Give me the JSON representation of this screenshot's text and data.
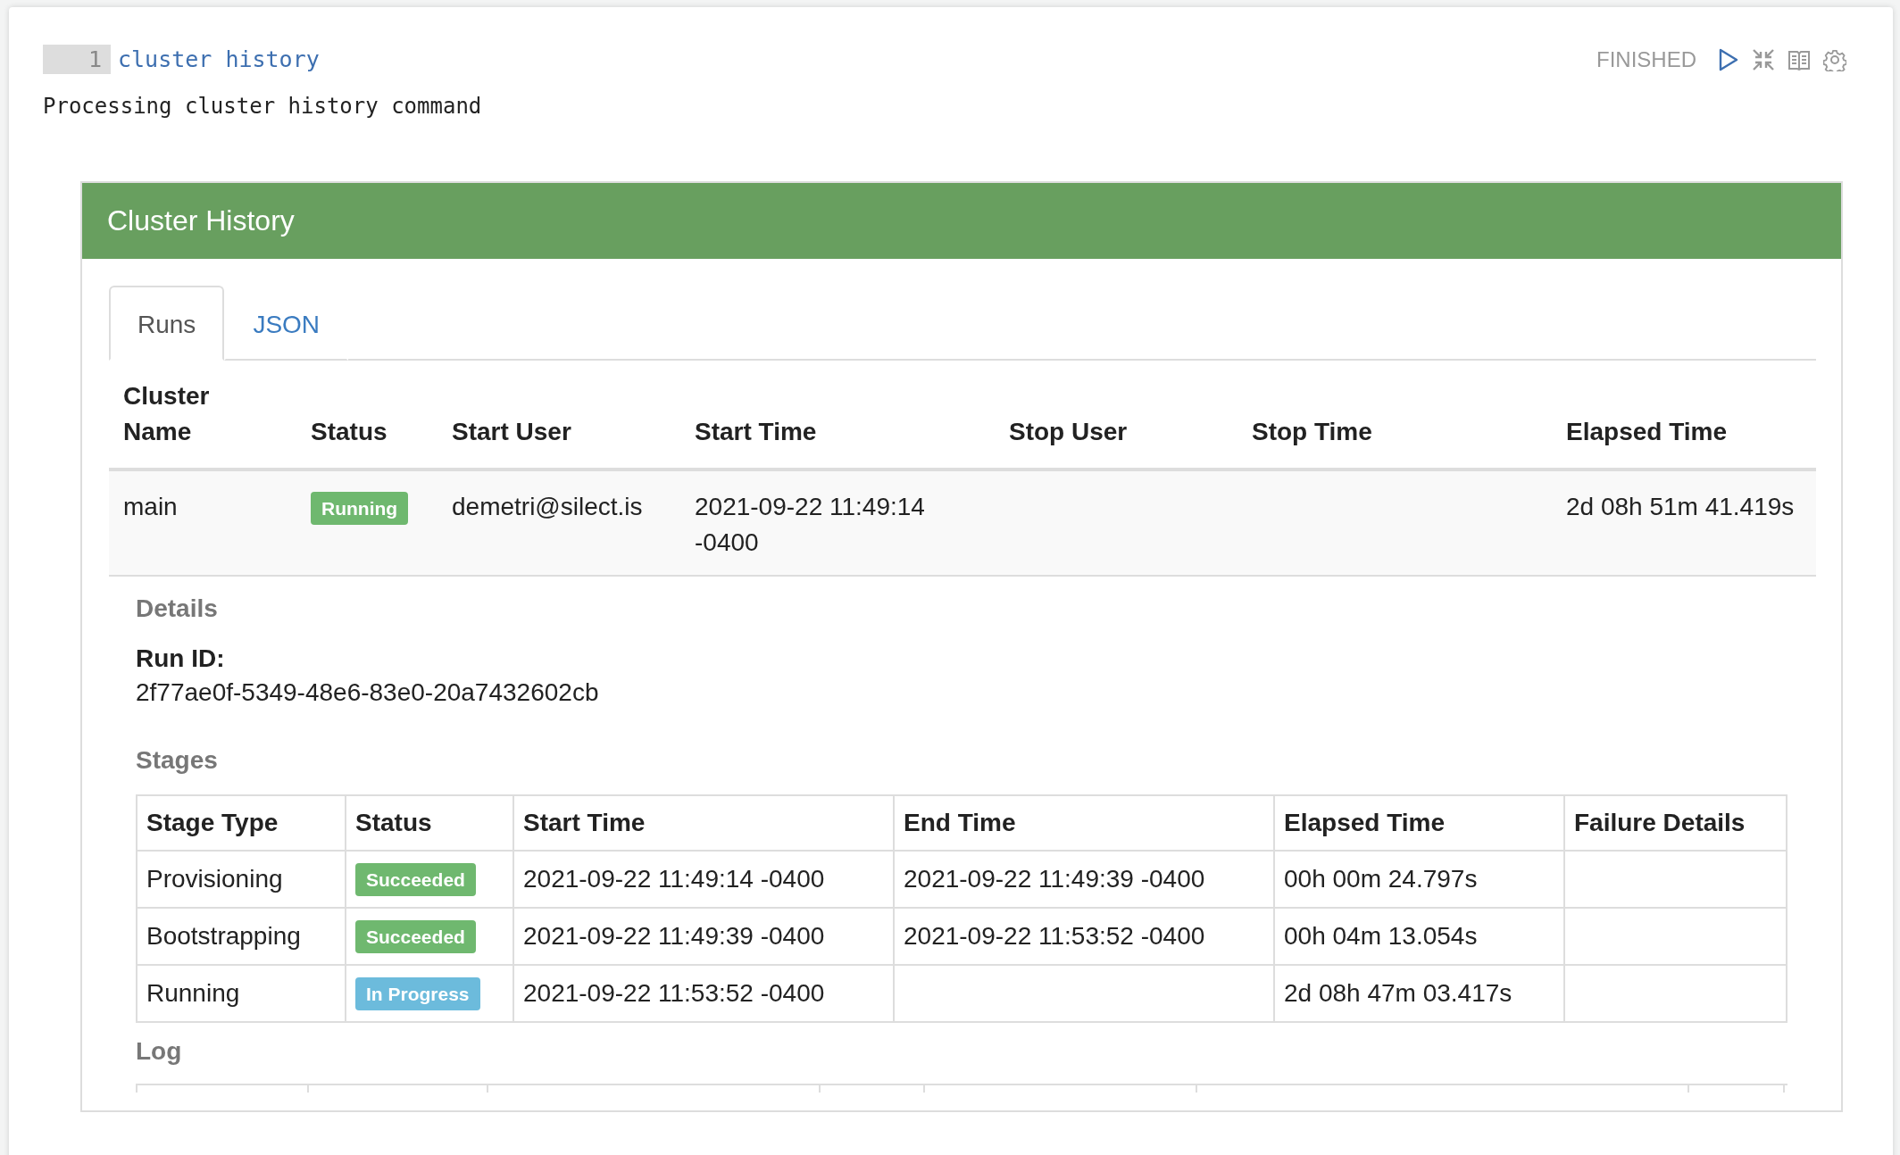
{
  "paragraph": {
    "line_number": "1",
    "code": "cluster history",
    "status": "FINISHED",
    "output": "Processing cluster history command"
  },
  "panel": {
    "title": "Cluster History",
    "tabs": [
      {
        "label": "Runs",
        "selected": true
      },
      {
        "label": "JSON",
        "selected": false
      }
    ],
    "runs": {
      "columns": [
        "Cluster Name",
        "Status",
        "Start User",
        "Start Time",
        "Stop User",
        "Stop Time",
        "Elapsed Time"
      ],
      "rows": [
        {
          "cluster_name": "main",
          "status": {
            "label": "Running",
            "color": "#6fb86f"
          },
          "start_user": "demetri@silect.is",
          "start_time": "2021-09-22 11:49:14 -0400",
          "stop_user": "",
          "stop_time": "",
          "elapsed_time": "2d 08h 51m 41.419s"
        }
      ]
    },
    "details": {
      "heading": "Details",
      "run_id_label": "Run ID:",
      "run_id": "2f77ae0f-5349-48e6-83e0-20a7432602cb",
      "stages_heading": "Stages",
      "stages": {
        "columns": [
          "Stage Type",
          "Status",
          "Start Time",
          "End Time",
          "Elapsed Time",
          "Failure Details"
        ],
        "rows": [
          {
            "stage_type": "Provisioning",
            "status": {
              "label": "Succeeded",
              "color": "#6fb86f"
            },
            "start_time": "2021-09-22 11:49:14 -0400",
            "end_time": "2021-09-22 11:49:39 -0400",
            "elapsed_time": "00h 00m 24.797s"
          },
          {
            "stage_type": "Bootstrapping",
            "status": {
              "label": "Succeeded",
              "color": "#6fb86f"
            },
            "start_time": "2021-09-22 11:49:39 -0400",
            "end_time": "2021-09-22 11:53:52 -0400",
            "elapsed_time": "00h 04m 13.054s"
          },
          {
            "stage_type": "Running",
            "status": {
              "label": "In Progress",
              "color": "#6cbbdc"
            },
            "start_time": "2021-09-22 11:53:52 -0400",
            "end_time": "",
            "elapsed_time": "2d 08h 47m 03.417s"
          }
        ]
      },
      "log_heading": "Log"
    }
  }
}
